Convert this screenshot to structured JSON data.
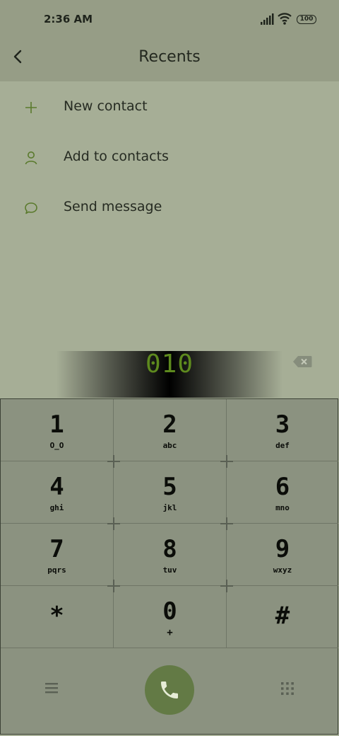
{
  "status_bar": {
    "time": "2:36 AM",
    "battery": "100"
  },
  "header": {
    "title": "Recents"
  },
  "menu": [
    {
      "label": "New contact",
      "icon": "plus-icon"
    },
    {
      "label": "Add to contacts",
      "icon": "person-icon"
    },
    {
      "label": "Send message",
      "icon": "chat-bubble-icon"
    }
  ],
  "dialer": {
    "number": "010",
    "keys": [
      {
        "digit": "1",
        "letters": "O_O"
      },
      {
        "digit": "2",
        "letters": "abc"
      },
      {
        "digit": "3",
        "letters": "def"
      },
      {
        "digit": "4",
        "letters": "ghi"
      },
      {
        "digit": "5",
        "letters": "jkl"
      },
      {
        "digit": "6",
        "letters": "mno"
      },
      {
        "digit": "7",
        "letters": "pqrs"
      },
      {
        "digit": "8",
        "letters": "tuv"
      },
      {
        "digit": "9",
        "letters": "wxyz"
      },
      {
        "digit": "*",
        "letters": ""
      },
      {
        "digit": "0",
        "letters": "+"
      },
      {
        "digit": "#",
        "letters": ""
      }
    ]
  },
  "colors": {
    "background": "#a6ae96",
    "keypad": "#8b9280",
    "call_button": "#637a45",
    "number_text": "#5e8a1e"
  }
}
